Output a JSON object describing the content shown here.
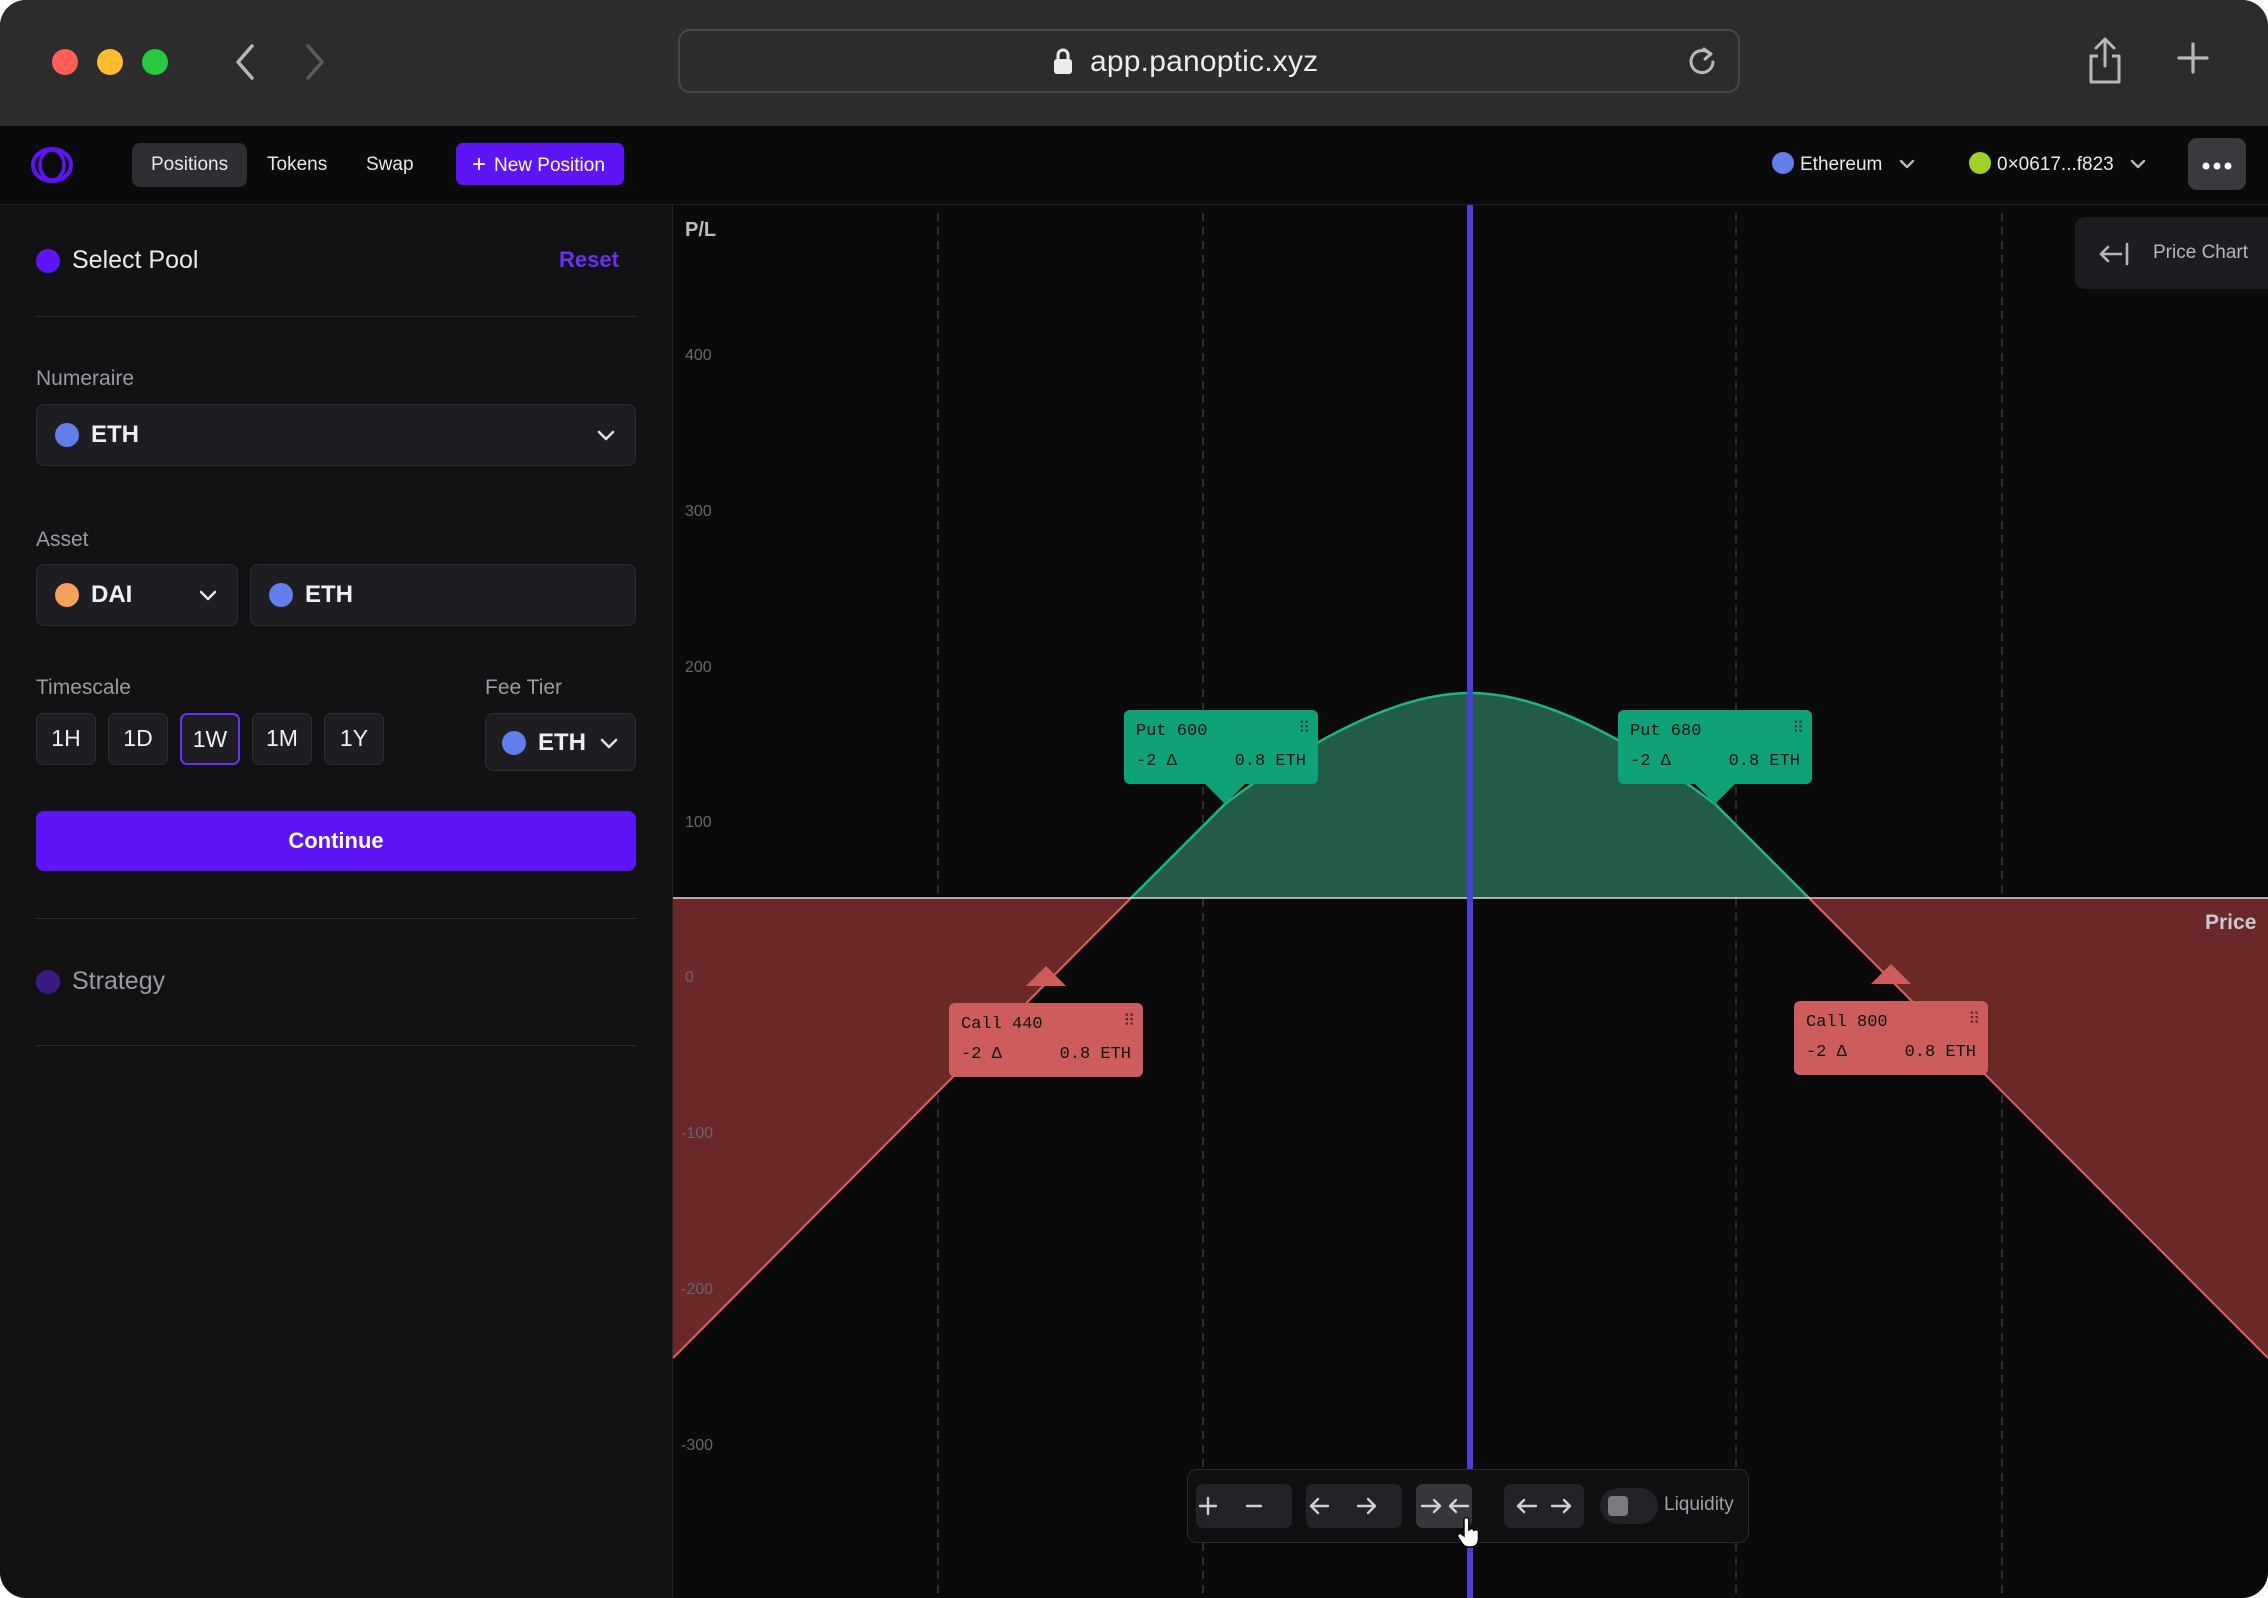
{
  "browser": {
    "url": "app.panoptic.xyz"
  },
  "nav": {
    "tabs": [
      "Positions",
      "Tokens",
      "Swap"
    ],
    "new_position": "New Position",
    "network": "Ethereum",
    "wallet": "0×0617...f823"
  },
  "panel": {
    "select_pool": "Select Pool",
    "reset": "Reset",
    "numeraire_label": "Numeraire",
    "numeraire_value": "ETH",
    "asset_label": "Asset",
    "asset_a": "DAI",
    "asset_b": "ETH",
    "timescale_label": "Timescale",
    "timescales": [
      "1H",
      "1D",
      "1W",
      "1M",
      "1Y"
    ],
    "selected_timescale": "1W",
    "fee_tier_label": "Fee Tier",
    "fee_tier_value": "ETH",
    "continue": "Continue",
    "strategy": "Strategy"
  },
  "chart": {
    "y_label": "P/L",
    "x_label": "Price",
    "y_ticks": [
      "400",
      "300",
      "200",
      "100",
      "0",
      "-100",
      "-200",
      "-300"
    ],
    "price_chart_button": "Price Chart",
    "legs": [
      {
        "title": "Put 600",
        "delta": "-2 Δ",
        "size": "0.8 ETH",
        "kind": "put"
      },
      {
        "title": "Put 680",
        "delta": "-2 Δ",
        "size": "0.8 ETH",
        "kind": "put"
      },
      {
        "title": "Call 440",
        "delta": "-2 Δ",
        "size": "0.8 ETH",
        "kind": "call"
      },
      {
        "title": "Call 800",
        "delta": "-2 Δ",
        "size": "0.8 ETH",
        "kind": "call"
      }
    ],
    "liquidity_label": "Liquidity",
    "colors": {
      "profit": "#0fa278",
      "loss": "#cd5c5c",
      "current_price": "#4a3fd6",
      "accent": "#5d15f5"
    }
  }
}
